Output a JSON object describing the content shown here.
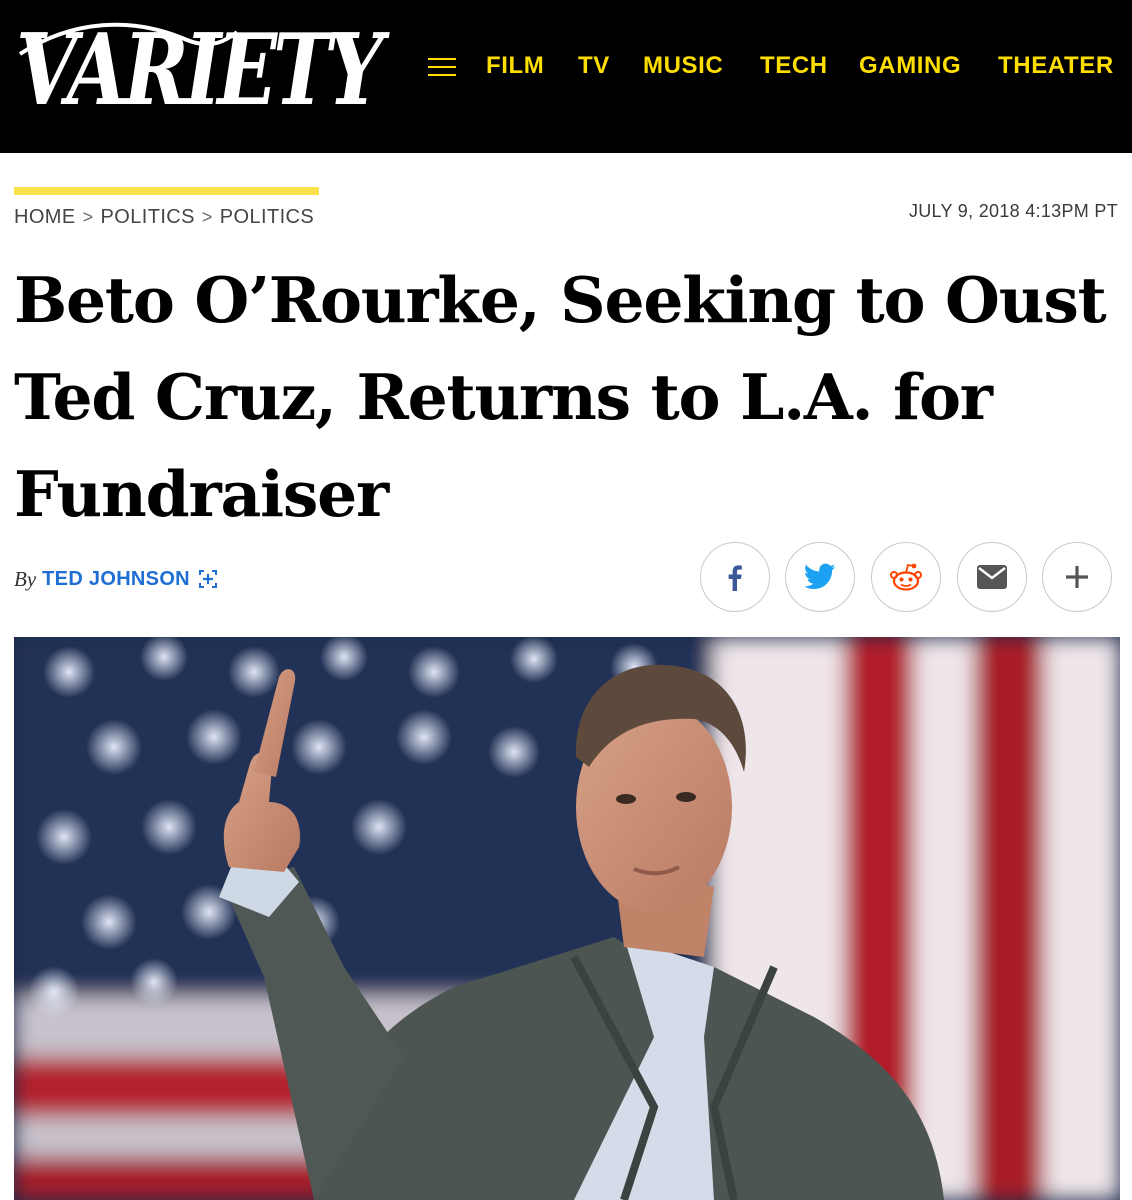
{
  "header": {
    "logo_text": "VARIETY",
    "nav": [
      {
        "label": "FILM"
      },
      {
        "label": "TV"
      },
      {
        "label": "MUSIC"
      },
      {
        "label": "TECH"
      },
      {
        "label": "GAMING"
      },
      {
        "label": "THEATER"
      }
    ],
    "menu_icon": "hamburger-menu-icon"
  },
  "breadcrumb": {
    "items": [
      "HOME",
      "POLITICS",
      "POLITICS"
    ],
    "separator": ">"
  },
  "timestamp": "JULY 9, 2018 4:13PM PT",
  "article": {
    "headline": "Beto O’Rourke, Seeking to Oust Ted Cruz, Returns to L.A. for Fundraiser",
    "byline_prefix": "By",
    "author": "TED JOHNSON",
    "follow_icon": "plus-bracket-icon"
  },
  "share_buttons": [
    {
      "name": "facebook",
      "icon": "facebook-icon",
      "color": "#3b5998"
    },
    {
      "name": "twitter",
      "icon": "twitter-icon",
      "color": "#1da1f2"
    },
    {
      "name": "reddit",
      "icon": "reddit-icon",
      "color": "#ff4500"
    },
    {
      "name": "email",
      "icon": "email-icon",
      "color": "#555555"
    },
    {
      "name": "more",
      "icon": "plus-icon",
      "color": "#555555"
    }
  ],
  "colors": {
    "header_bg": "#000000",
    "nav_yellow": "#fedd00",
    "accent_bar": "#fbe14a",
    "author_blue": "#1f6ed4"
  }
}
